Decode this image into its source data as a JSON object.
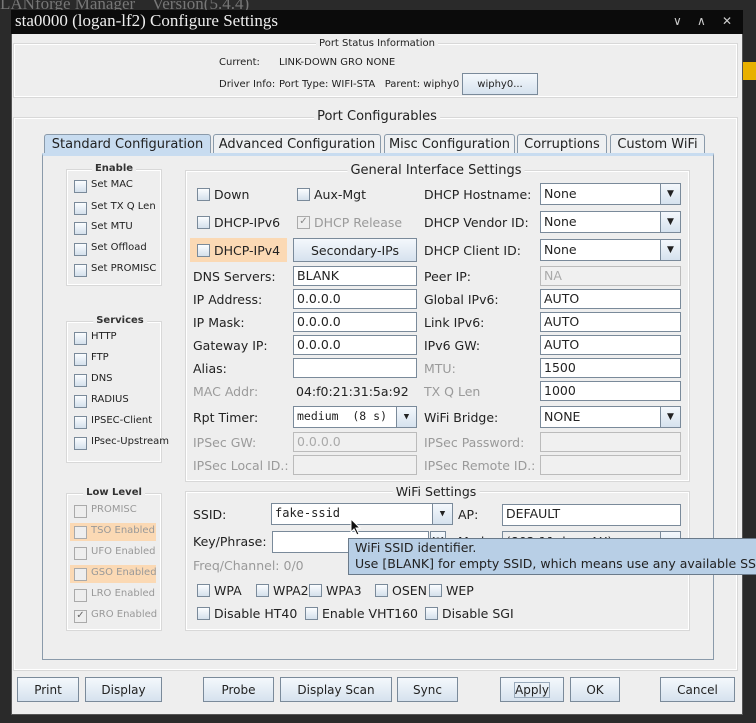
{
  "background": {
    "app_title": "LANforge Manager    Version(5.4.4)"
  },
  "window": {
    "title": "sta0000  (logan-lf2) Configure Settings",
    "min_icon": "chevron-down-icon",
    "max_icon": "chevron-up-icon",
    "close_icon": "close-icon"
  },
  "port_status": {
    "title": "Port Status Information",
    "current_label": "Current:",
    "current_value": "LINK-DOWN GRO  NONE",
    "driver_label": "Driver Info:",
    "driver_value": "Port Type: WIFI-STA   Parent: wiphy0",
    "wiphy_button": "wiphy0..."
  },
  "configurables": {
    "title": "Port Configurables"
  },
  "tabs": [
    {
      "label": "Standard Configuration",
      "selected": true
    },
    {
      "label": "Advanced Configuration"
    },
    {
      "label": "Misc Configuration"
    },
    {
      "label": "Corruptions"
    },
    {
      "label": "Custom WiFi"
    }
  ],
  "enable": {
    "title": "Enable",
    "items": [
      "Set MAC",
      "Set TX Q Len",
      "Set MTU",
      "Set Offload",
      "Set PROMISC"
    ]
  },
  "services": {
    "title": "Services",
    "items": [
      "HTTP",
      "FTP",
      "DNS",
      "RADIUS",
      "IPSEC-Client",
      "IPsec-Upstream"
    ]
  },
  "low_level": {
    "title": "Low Level",
    "items": [
      {
        "label": "PROMISC"
      },
      {
        "label": "TSO Enabled",
        "highlight": true
      },
      {
        "label": "UFO Enabled"
      },
      {
        "label": "GSO Enabled",
        "highlight": true
      },
      {
        "label": "LRO Enabled"
      },
      {
        "label": "GRO Enabled",
        "checked": true
      }
    ]
  },
  "general": {
    "title": "General Interface Settings",
    "down": "Down",
    "aux_mgt": "Aux-Mgt",
    "dhcp_ipv6": "DHCP-IPv6",
    "dhcp_release": "DHCP Release",
    "dhcp_ipv4": "DHCP-IPv4",
    "secondary_ips": "Secondary-IPs",
    "dhcp_hostname_label": "DHCP Hostname:",
    "dhcp_hostname": "None",
    "dhcp_vendor_label": "DHCP Vendor ID:",
    "dhcp_vendor": "None",
    "dhcp_client_label": "DHCP Client ID:",
    "dhcp_client": "None",
    "dns_label": "DNS Servers:",
    "dns": "BLANK",
    "peer_ip_label": "Peer IP:",
    "peer_ip": "NA",
    "ip_label": "IP Address:",
    "ip": "0.0.0.0",
    "global_ipv6_label": "Global IPv6:",
    "global_ipv6": "AUTO",
    "mask_label": "IP Mask:",
    "mask": "0.0.0.0",
    "link_ipv6_label": "Link IPv6:",
    "link_ipv6": "AUTO",
    "gw_label": "Gateway IP:",
    "gw": "0.0.0.0",
    "ipv6_gw_label": "IPv6 GW:",
    "ipv6_gw": "AUTO",
    "alias_label": "Alias:",
    "alias": "",
    "mtu_label": "MTU:",
    "mtu": "1500",
    "mac_label": "MAC Addr:",
    "mac": "04:f0:21:31:5a:92",
    "txq_label": "TX Q Len",
    "txq": "1000",
    "rpt_label": "Rpt Timer:",
    "rpt": "medium  (8 s)",
    "bridge_label": "WiFi Bridge:",
    "bridge": "NONE",
    "ipsec_gw_label": "IPSec GW:",
    "ipsec_gw": "0.0.0.0",
    "ipsec_pw_label": "IPSec Password:",
    "ipsec_pw": "",
    "ipsec_local_label": "IPSec Local ID.:",
    "ipsec_local": "",
    "ipsec_remote_label": "IPSec Remote ID.:",
    "ipsec_remote": ""
  },
  "wifi": {
    "title": "WiFi Settings",
    "ssid_label": "SSID:",
    "ssid": "fake-ssid",
    "ap_label": "AP:",
    "ap": "DEFAULT",
    "key_label": "Key/Phrase:",
    "key": "",
    "help_button": "[?]",
    "mode_label": "Mode",
    "mode": "(802.11abgn-AX)",
    "freq": "Freq/Channel: 0/0",
    "checks1": [
      "WPA",
      "WPA2",
      "WPA3",
      "OSEN",
      "WEP"
    ],
    "checks2": [
      "Disable HT40",
      "Enable VHT160",
      "Disable SGI"
    ]
  },
  "tooltip": {
    "line1": "WiFi SSID identifier.",
    "line2": "Use [BLANK] for empty SSID, which means use any available SSID."
  },
  "buttons": {
    "print": "Print",
    "display": "Display",
    "probe": "Probe",
    "display_scan": "Display Scan",
    "sync": "Sync",
    "apply": "Apply",
    "ok": "OK",
    "cancel": "Cancel"
  },
  "colors": {
    "highlight": "#fbd9b4",
    "tooltip": "#b8cfe6",
    "tab_selected": "#c8dcf0"
  }
}
